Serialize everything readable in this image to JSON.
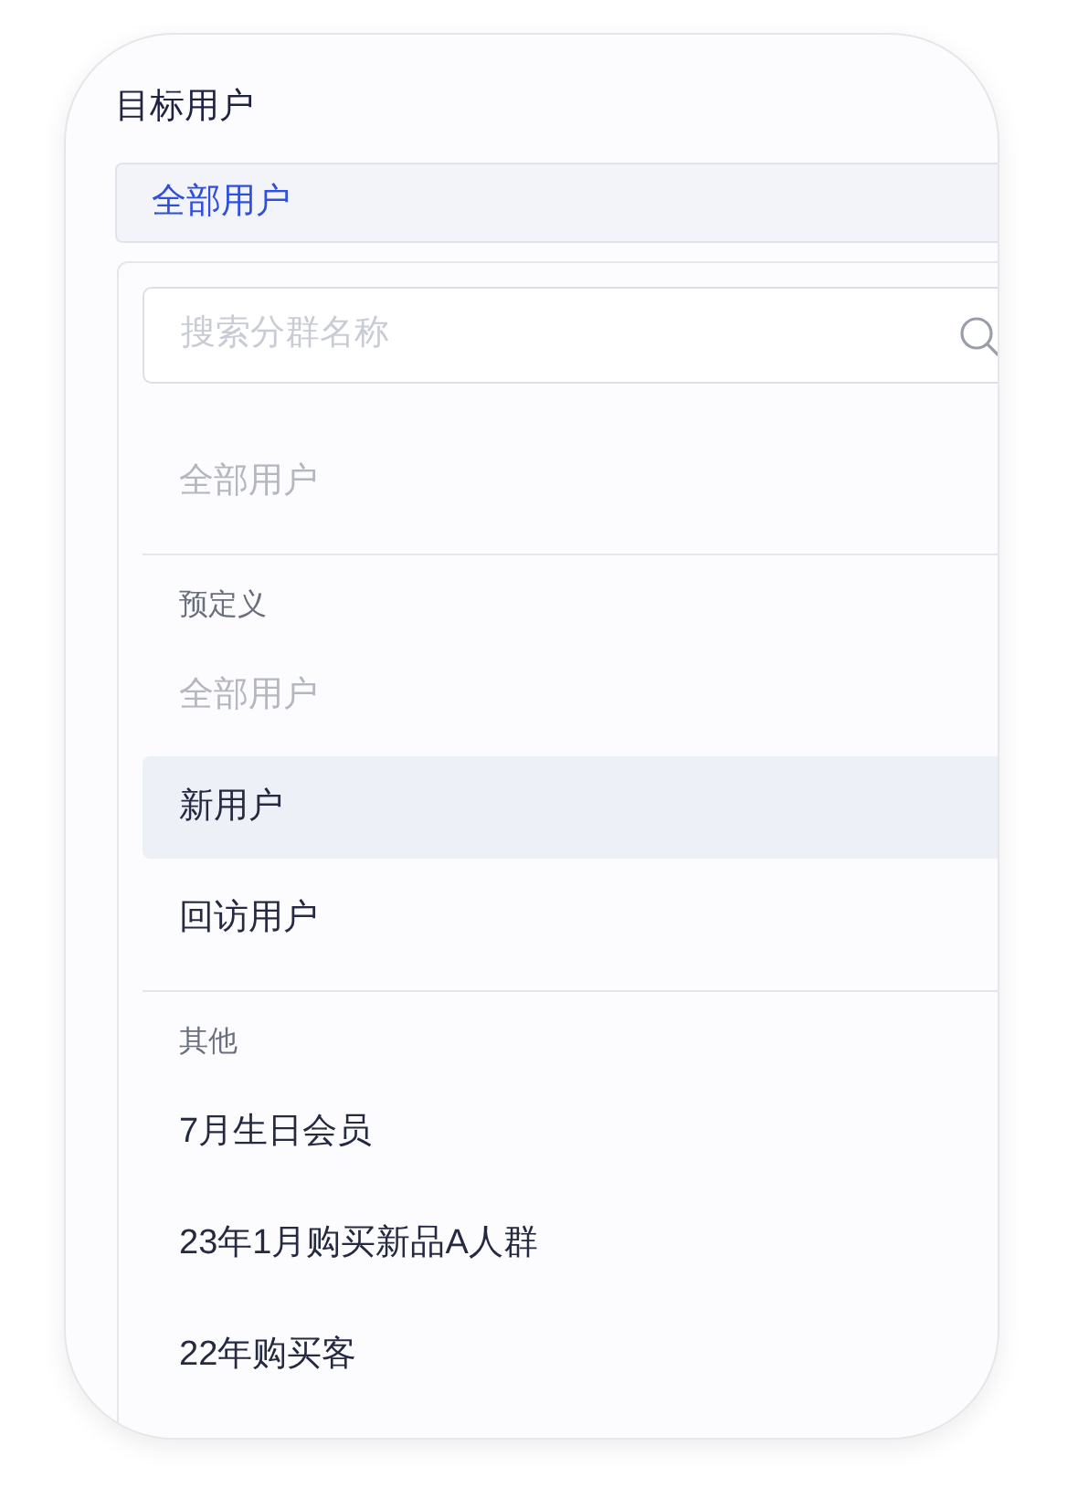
{
  "field": {
    "label": "目标用户",
    "value": "全部用户"
  },
  "dropdown": {
    "search": {
      "placeholder": "搜索分群名称"
    },
    "groups": [
      {
        "items": [
          {
            "label": "全部用户",
            "disabled": true,
            "selected": false
          }
        ]
      },
      {
        "title": "预定义",
        "items": [
          {
            "label": "全部用户",
            "disabled": true,
            "selected": false
          },
          {
            "label": "新用户",
            "disabled": false,
            "selected": true
          },
          {
            "label": "回访用户",
            "disabled": false,
            "selected": false
          }
        ]
      },
      {
        "title": "其他",
        "items": [
          {
            "label": "7月生日会员",
            "disabled": false,
            "selected": false
          },
          {
            "label": "23年1月购买新品A人群",
            "disabled": false,
            "selected": false
          },
          {
            "label": "22年购买客",
            "disabled": false,
            "selected": false
          }
        ]
      }
    ]
  }
}
